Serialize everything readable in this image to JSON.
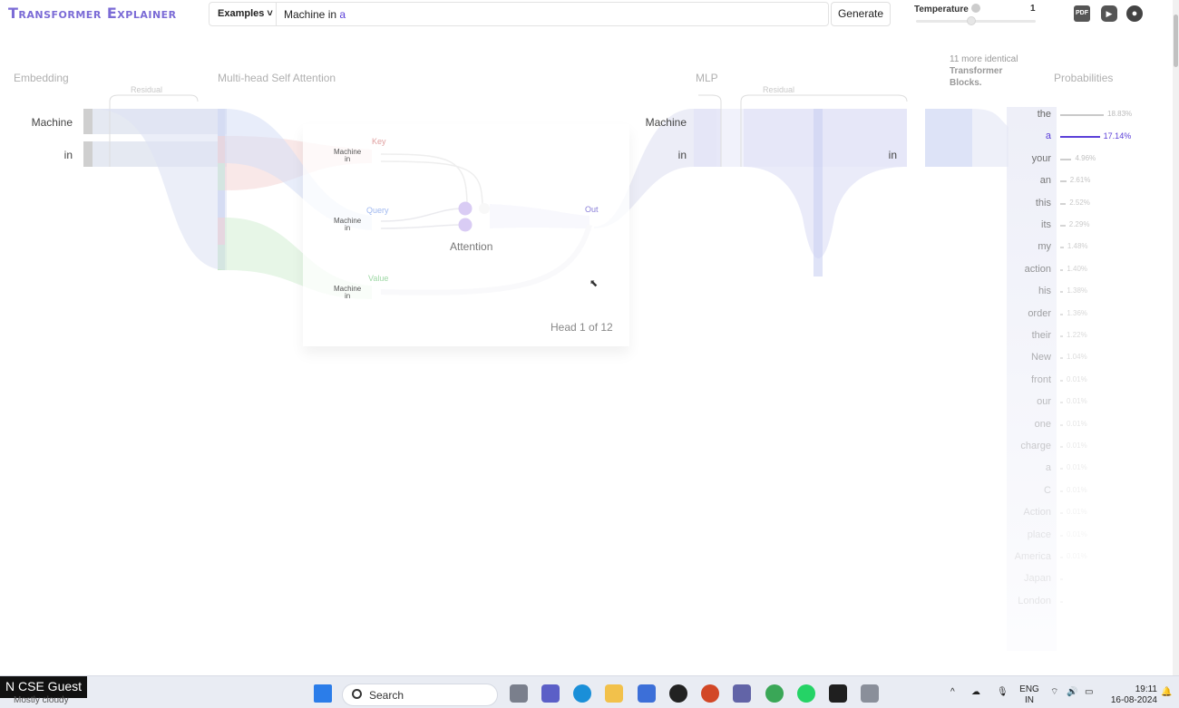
{
  "header": {
    "logo": "Transformer Explainer",
    "examples_label": "Examples ˅",
    "prompt_text": "Machine in ",
    "prompt_predicted": "a",
    "generate_label": "Generate",
    "temperature_label": "Temperature",
    "temperature_value": "1",
    "pdf_icon": "PDF"
  },
  "sections": {
    "embedding": "Embedding",
    "attention": "Multi-head Self Attention",
    "mlp": "MLP",
    "probabilities": "Probabilities",
    "residual_1": "Residual",
    "residual_2": "Residual",
    "more_blocks_line1": "11 more identical",
    "more_blocks_line2": "Transformer",
    "more_blocks_line3": "Blocks."
  },
  "tokens": [
    "Machine",
    "in"
  ],
  "attention_card": {
    "key_label": "Key",
    "query_label": "Query",
    "value_label": "Value",
    "attention_label": "Attention",
    "out_label": "Out",
    "head_label": "Head 1 of 12"
  },
  "mlp_tokens": {
    "left_machine": "Machine",
    "left_in": "in",
    "right_in": "in"
  },
  "probabilities": [
    {
      "word": "the",
      "pct": "18.83%",
      "bar": 1.0,
      "highlight": false
    },
    {
      "word": "a",
      "pct": "17.14%",
      "bar": 0.91,
      "highlight": true
    },
    {
      "word": "your",
      "pct": "4.96%",
      "bar": 0.26,
      "highlight": false
    },
    {
      "word": "an",
      "pct": "2.61%",
      "bar": 0.14,
      "highlight": false
    },
    {
      "word": "this",
      "pct": "2.52%",
      "bar": 0.13,
      "highlight": false
    },
    {
      "word": "its",
      "pct": "2.29%",
      "bar": 0.12,
      "highlight": false
    },
    {
      "word": "my",
      "pct": "1.48%",
      "bar": 0.08,
      "highlight": false
    },
    {
      "word": "action",
      "pct": "1.40%",
      "bar": 0.07,
      "highlight": false
    },
    {
      "word": "his",
      "pct": "1.38%",
      "bar": 0.07,
      "highlight": false
    },
    {
      "word": "order",
      "pct": "1.36%",
      "bar": 0.07,
      "highlight": false
    },
    {
      "word": "their",
      "pct": "1.22%",
      "bar": 0.06,
      "highlight": false
    },
    {
      "word": "New",
      "pct": "1.04%",
      "bar": 0.05,
      "highlight": false
    },
    {
      "word": "front",
      "pct": "0.01%",
      "bar": 0.0,
      "highlight": false
    },
    {
      "word": "our",
      "pct": "0.01%",
      "bar": 0.0,
      "highlight": false
    },
    {
      "word": "one",
      "pct": "0.01%",
      "bar": 0.0,
      "highlight": false
    },
    {
      "word": "charge",
      "pct": "0.01%",
      "bar": 0.0,
      "highlight": false
    },
    {
      "word": "a",
      "pct": "0.01%",
      "bar": 0.0,
      "highlight": false
    },
    {
      "word": "C",
      "pct": "0.01%",
      "bar": 0.0,
      "highlight": false
    },
    {
      "word": "Action",
      "pct": "0.01%",
      "bar": 0.0,
      "highlight": false
    },
    {
      "word": "place",
      "pct": "0.01%",
      "bar": 0.0,
      "highlight": false
    },
    {
      "word": "America",
      "pct": "0.01%",
      "bar": 0.0,
      "highlight": false
    },
    {
      "word": "Japan",
      "pct": "",
      "bar": 0.0,
      "highlight": false
    },
    {
      "word": "London",
      "pct": "",
      "bar": 0.0,
      "highlight": false
    }
  ],
  "taskbar": {
    "guest": "N CSE Guest",
    "weather": "Mostly cloudy",
    "search": "Search",
    "lang_1": "ENG",
    "lang_2": "IN",
    "time": "19:11",
    "date": "16-08-2024"
  },
  "colors": {
    "accent": "#5b3fd8",
    "key": "#e8a6a6",
    "query": "#9fb8f0",
    "value": "#9fd8a6"
  }
}
